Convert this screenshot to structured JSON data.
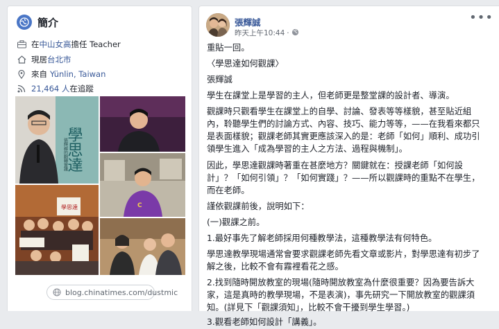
{
  "intro": {
    "title": "簡介",
    "work_prefix": "在",
    "work_place": "中山女高",
    "work_suffix": "擔任 Teacher",
    "lives_prefix": "現居",
    "lives_city": "台北市",
    "from_prefix": "來自",
    "from_place": "Yünlin, Taiwan",
    "followers_count": "21,464 人",
    "followers_suffix": "在追蹤",
    "blog_url": "blog.chinatimes.com/dustmic",
    "photo_caption_1": "學思達",
    "photo_caption_2": "張輝誠的翻轉實踐"
  },
  "post": {
    "author": "張輝誠",
    "time": "昨天上午10:44",
    "more_label": "•••",
    "lines": [
      "重貼一回。",
      "〈學思達如何觀課〉",
      "張輝誠",
      "學生在課堂上是學習的主人，但老師更是整堂課的設計者、導演。",
      "觀課時只觀看學生在課堂上的自學、討論、發表等等樣貌，甚至貼近組",
      "內，聆聽學生們的討論方式、內容、技巧、能力等等，——在我看來都只",
      "是表面樣貌；觀課老師其實更應該深入的是：老師「如何」順利、成功引",
      "領學生進入「成為學習的主人之方法、過程與機制」。",
      "因此，學思達觀課時著重在甚麼地方？關鍵就在：授課老師「如何設",
      "計」？「如何引領」？「如何實踐」？——所以觀課時的重點不在學生，",
      "而在老師。",
      "謹依觀課前後，說明如下：",
      "(一)觀課之前。",
      "1.最好事先了解老師採用何種教學法，這種教學法有何特色。",
      "學思達教學現場通常會要求觀課老師先看文章或影片，對學思達有初步了",
      "解之後，比較不會有霧裡看花之感。",
      "2.找到隨時開放教室的現場(隨時開放教室為什麼很重要？因為要告訴大",
      "家，這是真時的教學現場，不是表演)，事先研究一下開放教室的觀課須",
      "知。(詳見下「觀課須知」，比較不會干擾到學生學習。)",
      "3.觀看老師如何設計「講義」。"
    ]
  }
}
